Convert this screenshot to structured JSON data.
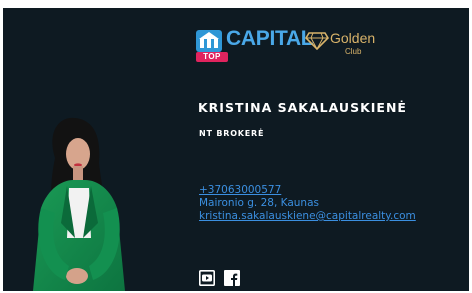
{
  "logo": {
    "brand_word": "CAPITAL",
    "badge_text": "TOP",
    "golden_word": "Golden",
    "club_word": "Club"
  },
  "person": {
    "name": "KRISTINA SAKALAUSKIENĖ",
    "role": "NT BROKERĖ"
  },
  "contact": {
    "phone": "+37063000577",
    "address": "Maironio g. 28, Kaunas",
    "email": "kristina.sakalauskiene@capitalrealty.com"
  },
  "social": {
    "icons": [
      "youtube-icon",
      "facebook-icon"
    ]
  },
  "colors": {
    "background": "#0e1a22",
    "link": "#3b8fe0",
    "brand_blue": "#4aa8e8",
    "brand_pink": "#e0245e",
    "gold": "#d8b36a"
  }
}
